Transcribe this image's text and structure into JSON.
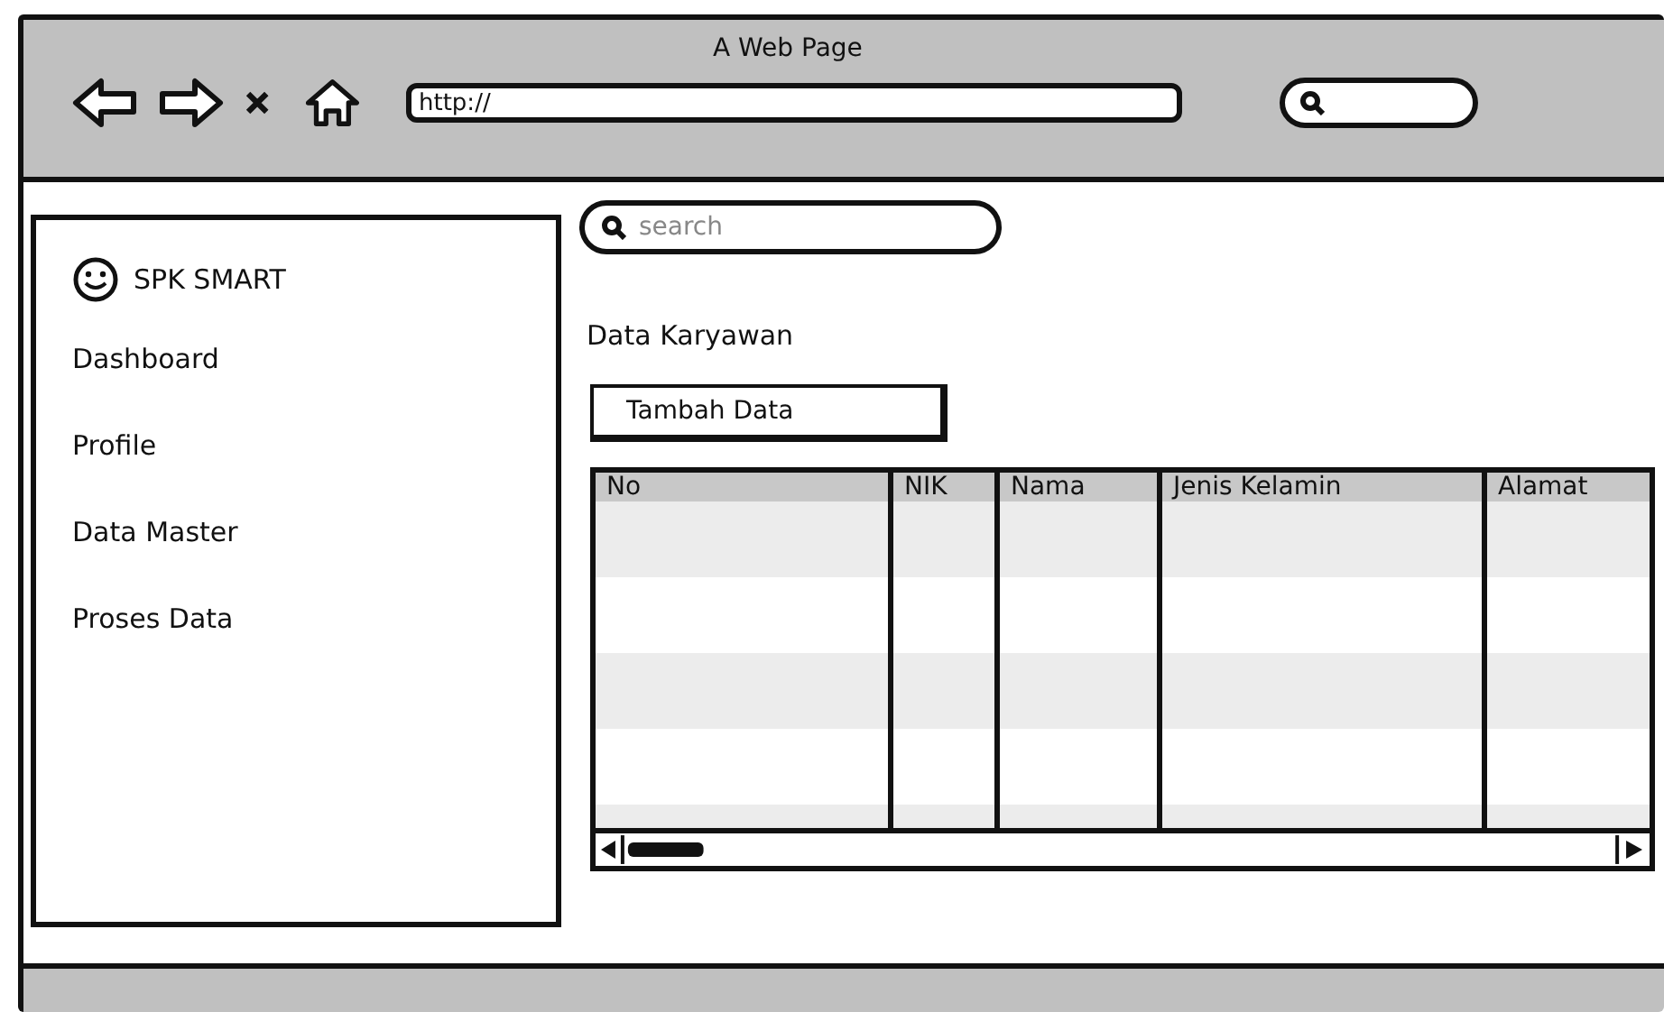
{
  "window": {
    "title": "A Web Page"
  },
  "browser": {
    "url": "http://"
  },
  "sidebar": {
    "brand": "SPK SMART",
    "items": [
      {
        "label": "Dashboard"
      },
      {
        "label": "Profile"
      },
      {
        "label": "Data Master"
      },
      {
        "label": "Proses Data"
      }
    ]
  },
  "search": {
    "placeholder": "search"
  },
  "page_title": "Data Karyawan",
  "add_button": "Tambah Data",
  "table": {
    "columns": [
      "No",
      "NIK",
      "Nama",
      "Jenis Kelamin",
      "Alamat"
    ]
  }
}
